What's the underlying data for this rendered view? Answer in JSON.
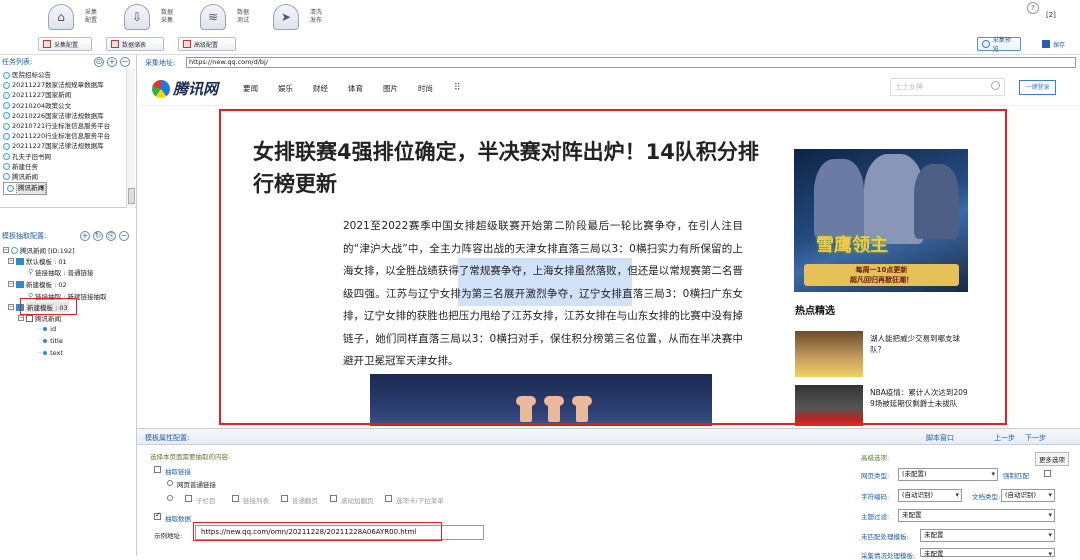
{
  "toolbar": {
    "buttons": [
      {
        "label": "采集\n配置"
      },
      {
        "label": "数据\n采集"
      },
      {
        "label": "数据\n测试"
      },
      {
        "label": "清洗\n发布"
      }
    ],
    "help": "?",
    "counter": "[2]"
  },
  "subbar": {
    "left": [
      "采集配置",
      "数据储表",
      "高级配置"
    ],
    "preview": "采集预览",
    "save": "保存"
  },
  "tasks": {
    "header": "任务列表:",
    "items": [
      "医院招标公告",
      "20211227数家法规规章数据库",
      "20211227国家新闻",
      "20210204政策公文",
      "20210226国家法律法规数据库",
      "20210721行业标准信息服务平台",
      "20211220行业标准信息服务平台",
      "20211227国家法律法规数据库",
      "孔夫子旧书网",
      "新建任务",
      "腾讯新闻",
      "腾讯新闻"
    ]
  },
  "templates": {
    "header": "模板抽取配置:",
    "root": "腾讯新闻 [ID:192]",
    "nodes": [
      "默认模板 : 01",
      "链接抽取 : 普通链接",
      "新建模板 : 02",
      "链接抽取 : 新建链接抽取",
      "新建模板 : 03",
      "腾讯新闻",
      "id",
      "title",
      "text"
    ]
  },
  "urlbar": {
    "label": "采集地址:",
    "value": "https://new.qq.com/d/bj/"
  },
  "site": {
    "logo": "腾讯网",
    "nav": [
      "要闻",
      "娱乐",
      "财经",
      "体育",
      "图片",
      "时尚"
    ],
    "grid": "⠿",
    "search_placeholder": "土土女神",
    "login": "一键登录",
    "title": "女排联赛4强排位确定，半决赛对阵出炉！14队积分排行榜更新",
    "body": "2021至2022赛季中国女排超级联赛开始第二阶段最后一轮比赛争夺，在引人注目的“津沪大战”中，全主力阵容出战的天津女排直落三局以3：0横扫实力有所保留的上海女排，以全胜战绩获得了常规赛争夺，上海女排虽然落败，但还是以常规赛第二名晋级四强。江苏与辽宁女排为第三名展开激烈争夺，辽宁女排直落三局3：0横扫广东女排，辽宁女排的获胜也把压力甩给了江苏女排，江苏女排在与山东女排的比赛中没有掉链子，她们同样直落三局以3：0横扫对手，保住积分榜第三名位置，从而在半决赛中避开卫冕冠军天津女排。",
    "ad": {
      "title": "雪鹰领主",
      "line1": "每周一10点更新",
      "line2": "超凡回归再掀狂潮！"
    },
    "hot_title": "热点精选",
    "hot": [
      {
        "text": "湖人能把威少交易到哪支球队？"
      },
      {
        "text": "NBA疫情：累计人次达到209 9场被延期仅剩爵士未拔队"
      }
    ]
  },
  "config": {
    "header": "模板属性配置:",
    "script": "脚本窗口",
    "prev": "上一步",
    "next": "下一步",
    "hint": "选择本页面需要抽取的内容:",
    "extract_link": "抽取链接",
    "normal_link": "网页普通链接",
    "opts": [
      "子栏目",
      "链接列表",
      "普通翻页",
      "滚动加翻页",
      "选项卡/下拉菜单"
    ],
    "extract_data": "抽取数据",
    "example_label": "示例地址:",
    "example_url": "https://new.qq.com/omn/20211228/20211228A06AYR00.html",
    "advanced": "高级选项:",
    "more": "更多选项",
    "page_type_label": "网页类型:",
    "page_type": "(未配置)",
    "force_match": "强制匹配",
    "charset_label": "字符编码:",
    "charset": "(自动识别)",
    "doc_type_label": "文档类型:",
    "doc_type": "(自动识别)",
    "topic_label": "主题过滤:",
    "topic": "未配置",
    "unmatched_label": "未匹配处理模板:",
    "unmatched": "未配置",
    "more_label": "采集情况处理模板:",
    "more_val": "未配置"
  },
  "colors": {
    "accent": "#1f5fae",
    "highlight": "#e02222"
  }
}
